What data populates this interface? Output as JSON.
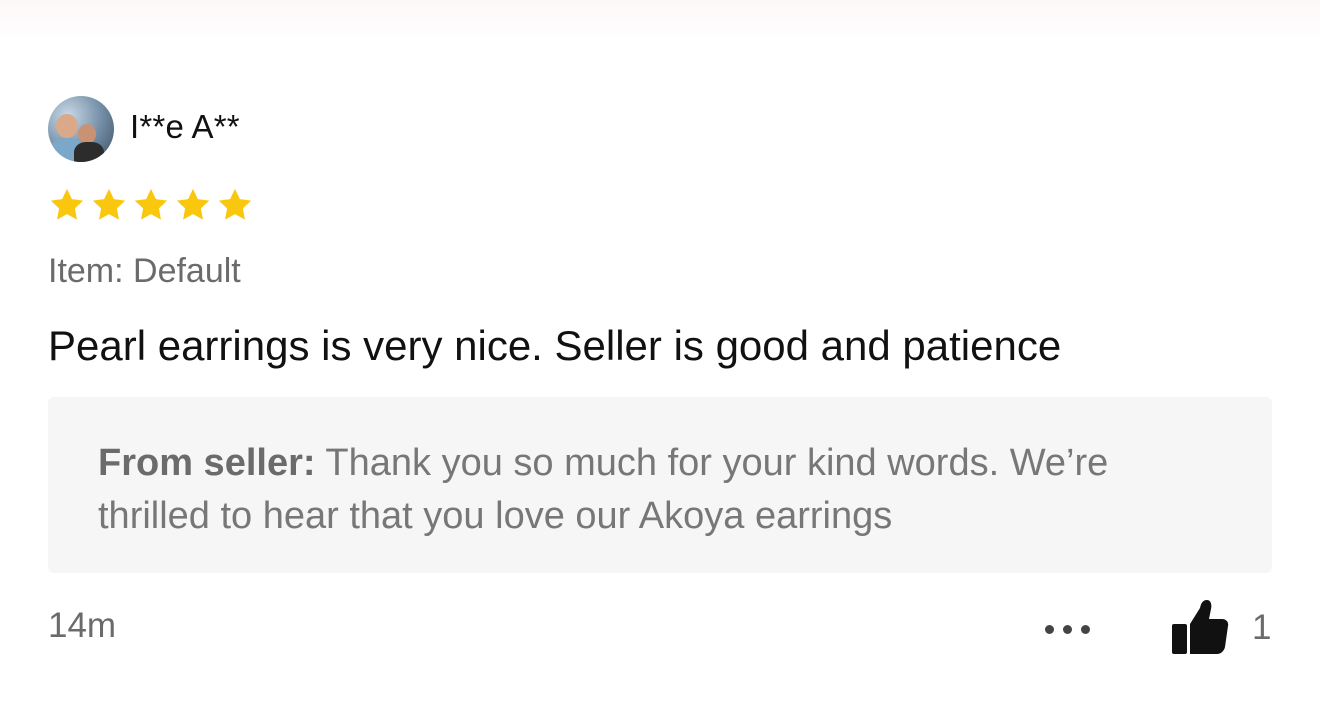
{
  "review": {
    "user_name": "I**e A**",
    "rating": 5,
    "rating_max": 5,
    "item_variant": "Item: Default",
    "text": "Pearl earrings is very nice. Seller is good and patience",
    "seller_reply": {
      "prefix": "From seller:",
      "text": " Thank you so much for your kind words. We’re thrilled to hear that you love our Akoya earrings"
    },
    "timestamp": "14m",
    "like_count": "1",
    "icons": {
      "more": "more-options-icon",
      "like": "thumbs-up-icon",
      "star": "star-icon"
    },
    "colors": {
      "star": "#F9C80E",
      "text_primary": "#111111",
      "text_secondary": "#6B6B6B",
      "reply_background": "#F6F6F6"
    }
  }
}
